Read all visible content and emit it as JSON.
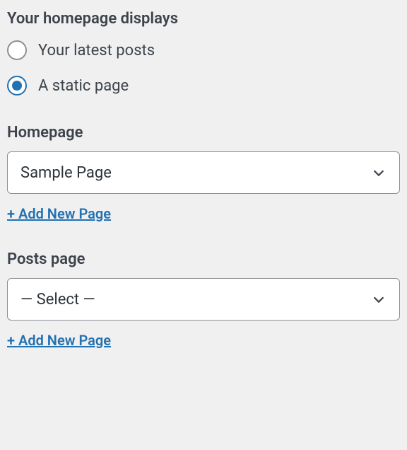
{
  "section": {
    "title": "Your homepage displays",
    "options": [
      {
        "label": "Your latest posts",
        "selected": false
      },
      {
        "label": "A static page",
        "selected": true
      }
    ]
  },
  "homepage": {
    "label": "Homepage",
    "selected": "Sample Page",
    "add_link": "+ Add New Page"
  },
  "posts_page": {
    "label": "Posts page",
    "selected": "— Select —",
    "add_link": "+ Add New Page"
  }
}
